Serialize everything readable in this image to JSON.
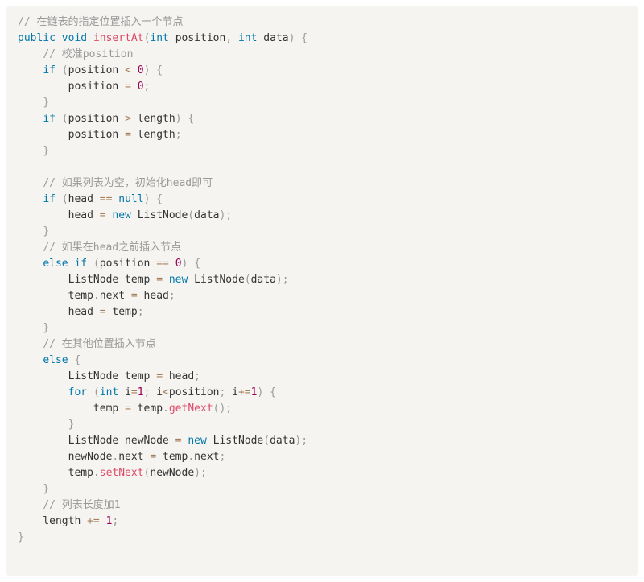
{
  "code": {
    "language": "java",
    "lines": [
      [
        {
          "t": "// 在链表的指定位置插入一个节点",
          "k": "comment"
        }
      ],
      [
        {
          "t": "public",
          "k": "keyword"
        },
        {
          "t": " ",
          "k": "plain"
        },
        {
          "t": "void",
          "k": "keyword"
        },
        {
          "t": " ",
          "k": "plain"
        },
        {
          "t": "insertAt",
          "k": "function"
        },
        {
          "t": "(",
          "k": "punct"
        },
        {
          "t": "int",
          "k": "keyword"
        },
        {
          "t": " position",
          "k": "plain"
        },
        {
          "t": ",",
          "k": "punct"
        },
        {
          "t": " ",
          "k": "plain"
        },
        {
          "t": "int",
          "k": "keyword"
        },
        {
          "t": " data",
          "k": "plain"
        },
        {
          "t": ")",
          "k": "punct"
        },
        {
          "t": " ",
          "k": "plain"
        },
        {
          "t": "{",
          "k": "punct"
        }
      ],
      [
        {
          "t": "    ",
          "k": "plain"
        },
        {
          "t": "// 校准position",
          "k": "comment"
        }
      ],
      [
        {
          "t": "    ",
          "k": "plain"
        },
        {
          "t": "if",
          "k": "keyword"
        },
        {
          "t": " ",
          "k": "plain"
        },
        {
          "t": "(",
          "k": "punct"
        },
        {
          "t": "position ",
          "k": "plain"
        },
        {
          "t": "<",
          "k": "operator"
        },
        {
          "t": " ",
          "k": "plain"
        },
        {
          "t": "0",
          "k": "number"
        },
        {
          "t": ")",
          "k": "punct"
        },
        {
          "t": " ",
          "k": "plain"
        },
        {
          "t": "{",
          "k": "punct"
        }
      ],
      [
        {
          "t": "        position ",
          "k": "plain"
        },
        {
          "t": "=",
          "k": "operator"
        },
        {
          "t": " ",
          "k": "plain"
        },
        {
          "t": "0",
          "k": "number"
        },
        {
          "t": ";",
          "k": "punct"
        }
      ],
      [
        {
          "t": "    ",
          "k": "plain"
        },
        {
          "t": "}",
          "k": "punct"
        }
      ],
      [
        {
          "t": "    ",
          "k": "plain"
        },
        {
          "t": "if",
          "k": "keyword"
        },
        {
          "t": " ",
          "k": "plain"
        },
        {
          "t": "(",
          "k": "punct"
        },
        {
          "t": "position ",
          "k": "plain"
        },
        {
          "t": ">",
          "k": "operator"
        },
        {
          "t": " length",
          "k": "plain"
        },
        {
          "t": ")",
          "k": "punct"
        },
        {
          "t": " ",
          "k": "plain"
        },
        {
          "t": "{",
          "k": "punct"
        }
      ],
      [
        {
          "t": "        position ",
          "k": "plain"
        },
        {
          "t": "=",
          "k": "operator"
        },
        {
          "t": " length",
          "k": "plain"
        },
        {
          "t": ";",
          "k": "punct"
        }
      ],
      [
        {
          "t": "    ",
          "k": "plain"
        },
        {
          "t": "}",
          "k": "punct"
        }
      ],
      [
        {
          "t": "",
          "k": "plain"
        }
      ],
      [
        {
          "t": "    ",
          "k": "plain"
        },
        {
          "t": "// 如果列表为空，初始化head即可",
          "k": "comment"
        }
      ],
      [
        {
          "t": "    ",
          "k": "plain"
        },
        {
          "t": "if",
          "k": "keyword"
        },
        {
          "t": " ",
          "k": "plain"
        },
        {
          "t": "(",
          "k": "punct"
        },
        {
          "t": "head ",
          "k": "plain"
        },
        {
          "t": "==",
          "k": "operator"
        },
        {
          "t": " ",
          "k": "plain"
        },
        {
          "t": "null",
          "k": "keyword"
        },
        {
          "t": ")",
          "k": "punct"
        },
        {
          "t": " ",
          "k": "plain"
        },
        {
          "t": "{",
          "k": "punct"
        }
      ],
      [
        {
          "t": "        head ",
          "k": "plain"
        },
        {
          "t": "=",
          "k": "operator"
        },
        {
          "t": " ",
          "k": "plain"
        },
        {
          "t": "new",
          "k": "keyword"
        },
        {
          "t": " ",
          "k": "plain"
        },
        {
          "t": "ListNode",
          "k": "plain"
        },
        {
          "t": "(",
          "k": "punct"
        },
        {
          "t": "data",
          "k": "plain"
        },
        {
          "t": ")",
          "k": "punct"
        },
        {
          "t": ";",
          "k": "punct"
        }
      ],
      [
        {
          "t": "    ",
          "k": "plain"
        },
        {
          "t": "}",
          "k": "punct"
        }
      ],
      [
        {
          "t": "    ",
          "k": "plain"
        },
        {
          "t": "// 如果在head之前插入节点",
          "k": "comment"
        }
      ],
      [
        {
          "t": "    ",
          "k": "plain"
        },
        {
          "t": "else",
          "k": "keyword"
        },
        {
          "t": " ",
          "k": "plain"
        },
        {
          "t": "if",
          "k": "keyword"
        },
        {
          "t": " ",
          "k": "plain"
        },
        {
          "t": "(",
          "k": "punct"
        },
        {
          "t": "position ",
          "k": "plain"
        },
        {
          "t": "==",
          "k": "operator"
        },
        {
          "t": " ",
          "k": "plain"
        },
        {
          "t": "0",
          "k": "number"
        },
        {
          "t": ")",
          "k": "punct"
        },
        {
          "t": " ",
          "k": "plain"
        },
        {
          "t": "{",
          "k": "punct"
        }
      ],
      [
        {
          "t": "        ListNode temp ",
          "k": "plain"
        },
        {
          "t": "=",
          "k": "operator"
        },
        {
          "t": " ",
          "k": "plain"
        },
        {
          "t": "new",
          "k": "keyword"
        },
        {
          "t": " ",
          "k": "plain"
        },
        {
          "t": "ListNode",
          "k": "plain"
        },
        {
          "t": "(",
          "k": "punct"
        },
        {
          "t": "data",
          "k": "plain"
        },
        {
          "t": ")",
          "k": "punct"
        },
        {
          "t": ";",
          "k": "punct"
        }
      ],
      [
        {
          "t": "        temp",
          "k": "plain"
        },
        {
          "t": ".",
          "k": "punct"
        },
        {
          "t": "next ",
          "k": "plain"
        },
        {
          "t": "=",
          "k": "operator"
        },
        {
          "t": " head",
          "k": "plain"
        },
        {
          "t": ";",
          "k": "punct"
        }
      ],
      [
        {
          "t": "        head ",
          "k": "plain"
        },
        {
          "t": "=",
          "k": "operator"
        },
        {
          "t": " temp",
          "k": "plain"
        },
        {
          "t": ";",
          "k": "punct"
        }
      ],
      [
        {
          "t": "    ",
          "k": "plain"
        },
        {
          "t": "}",
          "k": "punct"
        }
      ],
      [
        {
          "t": "    ",
          "k": "plain"
        },
        {
          "t": "// 在其他位置插入节点",
          "k": "comment"
        }
      ],
      [
        {
          "t": "    ",
          "k": "plain"
        },
        {
          "t": "else",
          "k": "keyword"
        },
        {
          "t": " ",
          "k": "plain"
        },
        {
          "t": "{",
          "k": "punct"
        }
      ],
      [
        {
          "t": "        ListNode temp ",
          "k": "plain"
        },
        {
          "t": "=",
          "k": "operator"
        },
        {
          "t": " head",
          "k": "plain"
        },
        {
          "t": ";",
          "k": "punct"
        }
      ],
      [
        {
          "t": "        ",
          "k": "plain"
        },
        {
          "t": "for",
          "k": "keyword"
        },
        {
          "t": " ",
          "k": "plain"
        },
        {
          "t": "(",
          "k": "punct"
        },
        {
          "t": "int",
          "k": "keyword"
        },
        {
          "t": " i",
          "k": "plain"
        },
        {
          "t": "=",
          "k": "operator"
        },
        {
          "t": "1",
          "k": "number"
        },
        {
          "t": ";",
          "k": "punct"
        },
        {
          "t": " i",
          "k": "plain"
        },
        {
          "t": "<",
          "k": "operator"
        },
        {
          "t": "position",
          "k": "plain"
        },
        {
          "t": ";",
          "k": "punct"
        },
        {
          "t": " i",
          "k": "plain"
        },
        {
          "t": "+=",
          "k": "operator"
        },
        {
          "t": "1",
          "k": "number"
        },
        {
          "t": ")",
          "k": "punct"
        },
        {
          "t": " ",
          "k": "plain"
        },
        {
          "t": "{",
          "k": "punct"
        }
      ],
      [
        {
          "t": "            temp ",
          "k": "plain"
        },
        {
          "t": "=",
          "k": "operator"
        },
        {
          "t": " temp",
          "k": "plain"
        },
        {
          "t": ".",
          "k": "punct"
        },
        {
          "t": "getNext",
          "k": "function"
        },
        {
          "t": "(",
          "k": "punct"
        },
        {
          "t": ")",
          "k": "punct"
        },
        {
          "t": ";",
          "k": "punct"
        }
      ],
      [
        {
          "t": "        ",
          "k": "plain"
        },
        {
          "t": "}",
          "k": "punct"
        }
      ],
      [
        {
          "t": "        ListNode newNode ",
          "k": "plain"
        },
        {
          "t": "=",
          "k": "operator"
        },
        {
          "t": " ",
          "k": "plain"
        },
        {
          "t": "new",
          "k": "keyword"
        },
        {
          "t": " ",
          "k": "plain"
        },
        {
          "t": "ListNode",
          "k": "plain"
        },
        {
          "t": "(",
          "k": "punct"
        },
        {
          "t": "data",
          "k": "plain"
        },
        {
          "t": ")",
          "k": "punct"
        },
        {
          "t": ";",
          "k": "punct"
        }
      ],
      [
        {
          "t": "        newNode",
          "k": "plain"
        },
        {
          "t": ".",
          "k": "punct"
        },
        {
          "t": "next ",
          "k": "plain"
        },
        {
          "t": "=",
          "k": "operator"
        },
        {
          "t": " temp",
          "k": "plain"
        },
        {
          "t": ".",
          "k": "punct"
        },
        {
          "t": "next",
          "k": "plain"
        },
        {
          "t": ";",
          "k": "punct"
        }
      ],
      [
        {
          "t": "        temp",
          "k": "plain"
        },
        {
          "t": ".",
          "k": "punct"
        },
        {
          "t": "setNext",
          "k": "function"
        },
        {
          "t": "(",
          "k": "punct"
        },
        {
          "t": "newNode",
          "k": "plain"
        },
        {
          "t": ")",
          "k": "punct"
        },
        {
          "t": ";",
          "k": "punct"
        }
      ],
      [
        {
          "t": "    ",
          "k": "plain"
        },
        {
          "t": "}",
          "k": "punct"
        }
      ],
      [
        {
          "t": "    ",
          "k": "plain"
        },
        {
          "t": "// 列表长度加1",
          "k": "comment"
        }
      ],
      [
        {
          "t": "    length ",
          "k": "plain"
        },
        {
          "t": "+=",
          "k": "operator"
        },
        {
          "t": " ",
          "k": "plain"
        },
        {
          "t": "1",
          "k": "number"
        },
        {
          "t": ";",
          "k": "punct"
        }
      ],
      [
        {
          "t": "}",
          "k": "punct"
        }
      ]
    ]
  },
  "colors": {
    "background": "#f6f4f1",
    "comment": "#999999",
    "keyword": "#0077aa",
    "function": "#dd4a68",
    "number": "#990055",
    "operator": "#a67f59",
    "punctuation": "#999999",
    "plain": "#333333"
  }
}
